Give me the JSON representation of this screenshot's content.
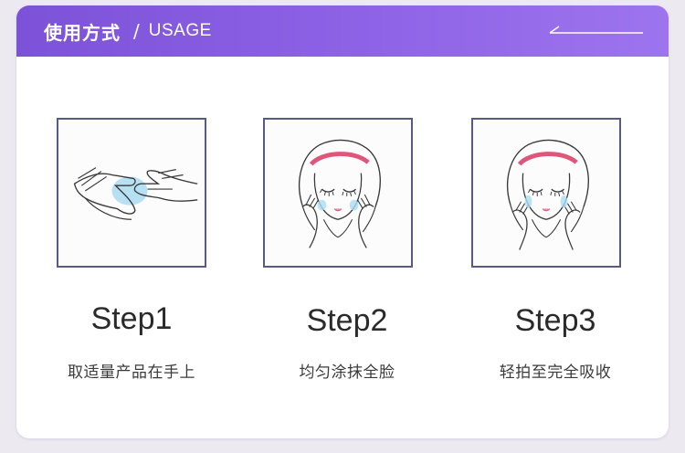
{
  "header": {
    "title_cn": "使用方式",
    "separator": "/",
    "title_en": "USAGE"
  },
  "steps": [
    {
      "title": "Step1",
      "desc": "取适量产品在手上",
      "illustration": "hands-with-product-illustration"
    },
    {
      "title": "Step2",
      "desc": "均匀涂抹全脸",
      "illustration": "face-applying-illustration"
    },
    {
      "title": "Step3",
      "desc": "轻拍至完全吸收",
      "illustration": "face-patting-illustration"
    }
  ],
  "colors": {
    "header_start": "#7c52d8",
    "header_end": "#9d74ee",
    "frame_border": "#575a82",
    "headband": "#e0567a",
    "cream": "#a9dcf0"
  }
}
